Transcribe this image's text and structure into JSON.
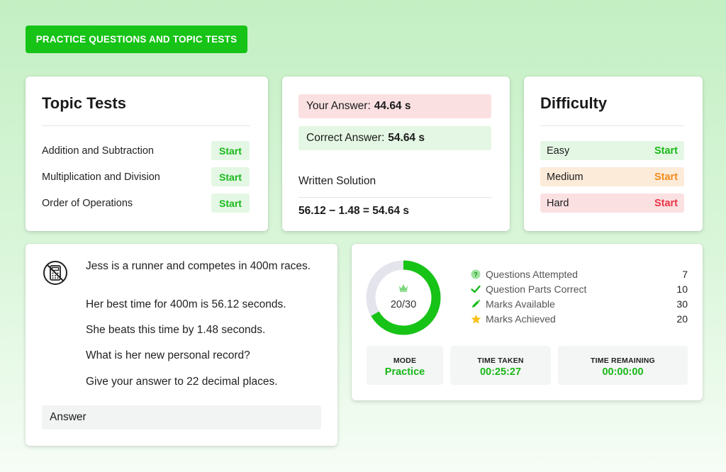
{
  "banner": "PRACTICE QUESTIONS AND TOPIC TESTS",
  "topic_tests": {
    "title": "Topic Tests",
    "items": [
      {
        "label": "Addition and Subtraction",
        "action": "Start"
      },
      {
        "label": "Multiplication and Division",
        "action": "Start"
      },
      {
        "label": "Order of Operations",
        "action": "Start"
      }
    ]
  },
  "answer_panel": {
    "your_answer_label": "Your Answer:",
    "your_answer_value": "44.64 s",
    "correct_answer_label": "Correct Answer:",
    "correct_answer_value": "54.64 s",
    "solution_title": "Written Solution",
    "solution_text": "56.12 − 1.48 = 54.64 s"
  },
  "difficulty": {
    "title": "Difficulty",
    "levels": [
      {
        "label": "Easy",
        "action": "Start",
        "color": "#18b918"
      },
      {
        "label": "Medium",
        "action": "Start",
        "color": "#f28a1d"
      },
      {
        "label": "Hard",
        "action": "Start",
        "color": "#ea3445"
      }
    ]
  },
  "question": {
    "icon": "no-calculator-icon",
    "lines": [
      "Jess is a runner and competes in 400m races.",
      "Her best time for 400m is 56.12 seconds.",
      "She beats this time by 1.48 seconds.",
      "What is her new personal record?",
      "Give your answer to 22 decimal places."
    ],
    "answer_placeholder": "Answer"
  },
  "stats": {
    "score_text": "20/30",
    "score_fraction": 0.6667,
    "rows": [
      {
        "label": "Questions Attempted",
        "value": "7",
        "icon": "question-circle-icon"
      },
      {
        "label": "Question Parts Correct",
        "value": "10",
        "icon": "checkmark-icon"
      },
      {
        "label": "Marks Available",
        "value": "30",
        "icon": "pencil-icon"
      },
      {
        "label": "Marks Achieved",
        "value": "20",
        "icon": "star-icon"
      }
    ],
    "tiles": [
      {
        "label": "MODE",
        "value": "Practice"
      },
      {
        "label": "TIME TAKEN",
        "value": "00:25:27"
      },
      {
        "label": "TIME REMAINING",
        "value": "00:00:00"
      }
    ]
  },
  "colors": {
    "accent": "#16c316",
    "accent_text": "#18b918",
    "wrong_bg": "#fbe0e2",
    "right_bg": "#e4f7e4",
    "donut_track": "#e3e4ec"
  }
}
